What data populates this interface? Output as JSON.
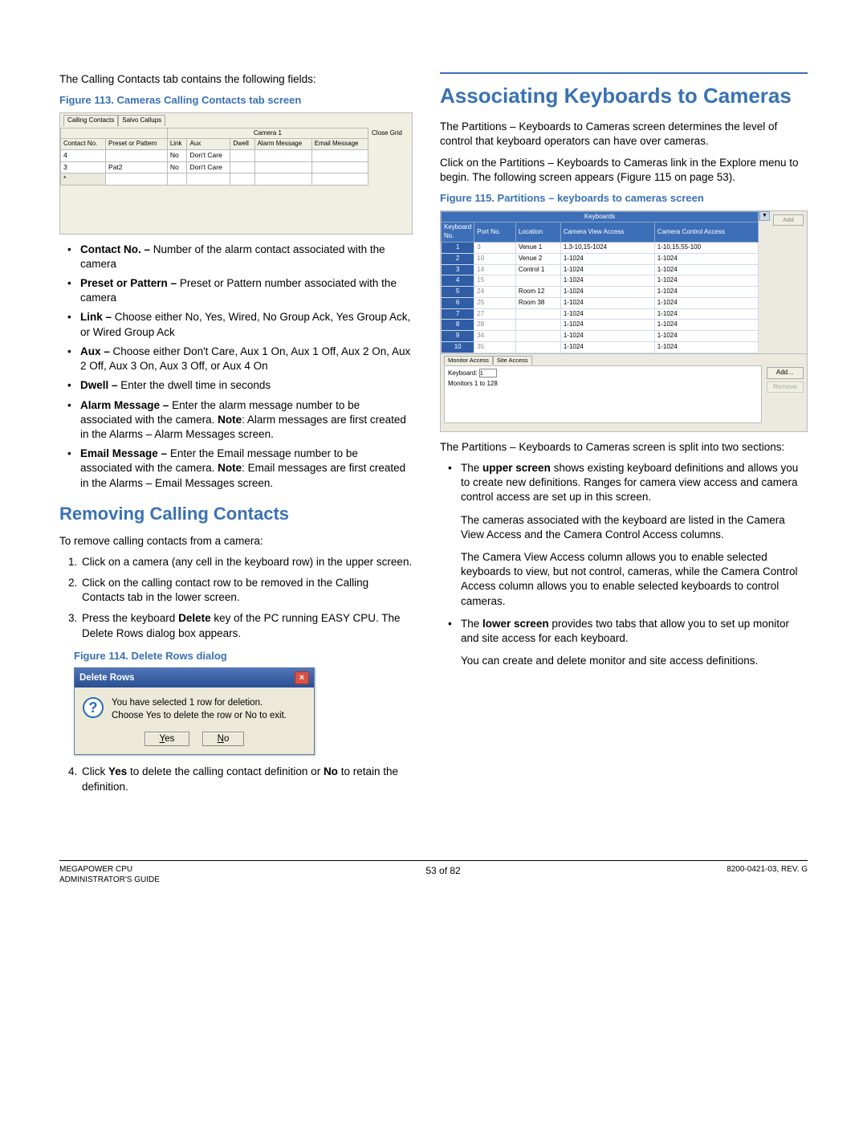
{
  "left": {
    "intro": "The Calling Contacts tab contains the following fields:",
    "fig113_caption": "Figure 113. Cameras Calling Contacts tab screen",
    "fig113": {
      "tab1": "Calling Contacts",
      "tab2": "Salvo Callups",
      "group_header": "Camera 1",
      "close_grid": "Close Grid",
      "headers": {
        "contact": "Contact No.",
        "preset": "Preset or Pattern",
        "link": "Link",
        "aux": "Aux",
        "dwell": "Dwell",
        "alarm": "Alarm Message",
        "email": "Email Message"
      },
      "rows": [
        {
          "contact": "4",
          "preset": "",
          "link": "No",
          "aux": "Don't Care",
          "dwell": "",
          "alarm": "",
          "email": ""
        },
        {
          "contact": "3",
          "preset": "Pat2",
          "link": "No",
          "aux": "Don't Care",
          "dwell": "",
          "alarm": "",
          "email": ""
        }
      ]
    },
    "bullets": [
      {
        "term": "Contact No. – ",
        "desc": "Number of the alarm contact associated with the camera"
      },
      {
        "term": "Preset or Pattern – ",
        "desc": "Preset or Pattern number associated with the camera"
      },
      {
        "term": "Link – ",
        "desc": "Choose either No, Yes, Wired, No Group Ack, Yes Group Ack, or Wired Group Ack"
      },
      {
        "term": "Aux – ",
        "desc": "Choose either Don't Care, Aux 1 On, Aux 1 Off, Aux 2 On, Aux 2 Off, Aux 3 On, Aux 3 Off, or Aux 4 On"
      },
      {
        "term": "Dwell – ",
        "desc": "Enter the dwell time in seconds"
      },
      {
        "term": "Alarm Message – ",
        "desc_pre": "Enter the alarm message number to be associated with the camera. ",
        "note": "Note",
        "desc_post": ": Alarm messages are first created in the Alarms – Alarm Messages screen."
      },
      {
        "term": "Email Message – ",
        "desc_pre": "Enter the Email message number to be associated with the camera. ",
        "note": "Note",
        "desc_post": ": Email messages are first created in the Alarms – Email Messages screen."
      }
    ],
    "removing_header": "Removing Calling Contacts",
    "removing_intro": "To remove calling contacts from a camera:",
    "steps": {
      "s1": "Click on a camera (any cell in the keyboard row) in the upper screen.",
      "s2": "Click on the calling contact row to be removed in the Calling Contacts tab in the lower screen.",
      "s3_a": "Press the keyboard ",
      "s3_b": "Delete",
      "s3_c": " key of the PC running EASY CPU. The Delete Rows dialog box appears.",
      "s4_a": "Click ",
      "s4_b": "Yes",
      "s4_c": " to delete the calling contact definition or ",
      "s4_d": "No",
      "s4_e": " to retain the definition."
    },
    "fig114_caption": "Figure 114. Delete Rows dialog",
    "fig114": {
      "title": "Delete Rows",
      "line1": "You have selected 1 row for deletion.",
      "line2": "Choose Yes to delete the row or No to exit.",
      "yes": "Yes",
      "no": "No"
    }
  },
  "right": {
    "major_header": "Associating Keyboards to Cameras",
    "p1": "The Partitions – Keyboards to Cameras screen determines the level of control that keyboard operators can have over cameras.",
    "p2": "Click on the Partitions – Keyboards to Cameras link in the Explore menu to begin. The following screen appears (Figure 115 on page 53).",
    "fig115_caption": "Figure 115. Partitions – keyboards to cameras screen",
    "fig115": {
      "title": "Keyboards",
      "add_btn": "Add",
      "headers": {
        "kb": "Keyboard No.",
        "port": "Port No.",
        "loc": "Location",
        "view": "Camera View Access",
        "ctrl": "Camera Control Access"
      },
      "rows": [
        {
          "k": "1",
          "port": "3",
          "loc": "Venue 1",
          "view": "1,3-10,15-1024",
          "ctrl": "1-10,15,55-100"
        },
        {
          "k": "2",
          "port": "10",
          "loc": "Venue 2",
          "view": "1-1024",
          "ctrl": "1-1024"
        },
        {
          "k": "3",
          "port": "14",
          "loc": "Control 1",
          "view": "1-1024",
          "ctrl": "1-1024"
        },
        {
          "k": "4",
          "port": "15",
          "loc": "",
          "view": "1-1024",
          "ctrl": "1-1024"
        },
        {
          "k": "5",
          "port": "24",
          "loc": "Room 12",
          "view": "1-1024",
          "ctrl": "1-1024"
        },
        {
          "k": "6",
          "port": "25",
          "loc": "Room 38",
          "view": "1-1024",
          "ctrl": "1-1024"
        },
        {
          "k": "7",
          "port": "27",
          "loc": "",
          "view": "1-1024",
          "ctrl": "1-1024"
        },
        {
          "k": "8",
          "port": "28",
          "loc": "",
          "view": "1-1024",
          "ctrl": "1-1024"
        },
        {
          "k": "9",
          "port": "34",
          "loc": "",
          "view": "1-1024",
          "ctrl": "1-1024"
        },
        {
          "k": "10",
          "port": "35",
          "loc": "",
          "view": "1-1024",
          "ctrl": "1-1024"
        }
      ],
      "lower_tab1": "Monitor Access",
      "lower_tab2": "Site Access",
      "kb_label": "Keyboard:",
      "kb_value": "1",
      "monitors_label": "Monitors 1 to 128",
      "lower_add": "Add…",
      "lower_remove": "Remove"
    },
    "p3": "The Partitions – Keyboards to Cameras screen is split into two sections:",
    "bul1_a": "The ",
    "bul1_b": "upper screen",
    "bul1_c": " shows existing keyboard definitions and allows you to create new definitions. Ranges for camera view access and camera control access are set up in this screen.",
    "sub1": "The cameras associated with the keyboard are listed in the Camera View Access and the Camera Control Access columns.",
    "sub2": "The Camera View Access column allows you to enable selected keyboards to view, but not control, cameras, while the Camera Control Access column allows you to enable selected keyboards to control cameras.",
    "bul2_a": "The ",
    "bul2_b": "lower screen",
    "bul2_c": " provides two tabs that allow you to set up monitor and site access for each keyboard.",
    "sub3": "You can create and delete monitor and site access definitions."
  },
  "footer": {
    "left1": "MEGAPOWER CPU",
    "left2": "ADMINISTRATOR'S GUIDE",
    "center": "53 of 82",
    "right": "8200-0421-03, REV. G"
  }
}
